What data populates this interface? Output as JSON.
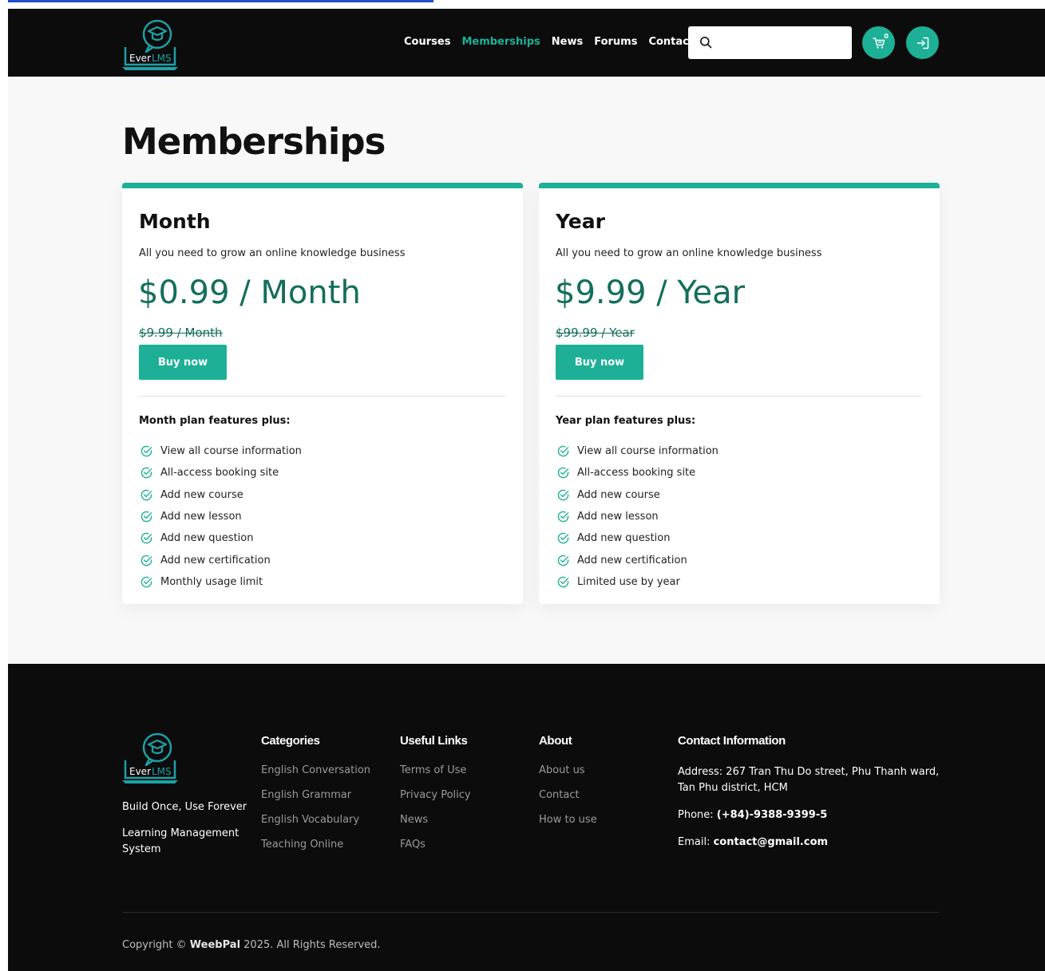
{
  "brand": {
    "logo_text_ever": "Ever",
    "logo_text_lms": "LMS",
    "colors": {
      "accent": "#1db096",
      "price": "#136e5c",
      "header_bg": "#0c0c0c",
      "logo": "#1da1a6"
    }
  },
  "header": {
    "nav": [
      {
        "label": "Courses",
        "active": false
      },
      {
        "label": "Memberships",
        "active": true
      },
      {
        "label": "News",
        "active": false
      },
      {
        "label": "Forums",
        "active": false
      },
      {
        "label": "Contact Us",
        "active": false
      }
    ],
    "search": {
      "placeholder": "",
      "value": "",
      "icon": "search-icon"
    },
    "cart": {
      "count": "0",
      "icon": "cart-icon"
    },
    "login": {
      "icon": "login-icon"
    }
  },
  "main": {
    "title": "Memberships",
    "plans": [
      {
        "name": "Month",
        "description": "All you need to grow an online knowledge business",
        "price": "$0.99 / Month",
        "old_price": "$9.99 / Month",
        "buy_label": "Buy now",
        "features_title": "Month plan features plus:",
        "features": [
          "View all course information",
          "All-access booking site",
          "Add new course",
          "Add new lesson",
          "Add new question",
          "Add new certification",
          "Monthly usage limit"
        ]
      },
      {
        "name": "Year",
        "description": "All you need to grow an online knowledge business",
        "price": "$9.99 / Year",
        "old_price": "$99.99 / Year",
        "buy_label": "Buy now",
        "features_title": "Year plan features plus:",
        "features": [
          "View all course information",
          "All-access booking site",
          "Add new course",
          "Add new lesson",
          "Add new question",
          "Add new certification",
          "Limited use by year"
        ]
      }
    ]
  },
  "footer": {
    "tagline_1": "Build Once, Use Forever",
    "tagline_2": "Learning Management System",
    "categories": {
      "title": "Categories",
      "items": [
        "English Conversation",
        "English Grammar",
        "English Vocabulary",
        "Teaching Online"
      ]
    },
    "useful_links": {
      "title": "Useful Links",
      "items": [
        "Terms of Use",
        "Privacy Policy",
        "News",
        "FAQs"
      ]
    },
    "about": {
      "title": "About",
      "items": [
        "About us",
        "Contact",
        "How to use"
      ]
    },
    "contact": {
      "title": "Contact Information",
      "address_label": "Address:",
      "address": "267 Tran Thu Do street, Phu Thanh ward, Tan Phu district, HCM",
      "phone_label": "Phone:",
      "phone": "(+84)-9388-9399-5",
      "email_label": "Email:",
      "email": "contact@gmail.com"
    },
    "copyright_prefix": "Copyright ©",
    "copyright_brand": "WeebPal",
    "copyright_suffix": " 2025. All Rights Reserved."
  }
}
